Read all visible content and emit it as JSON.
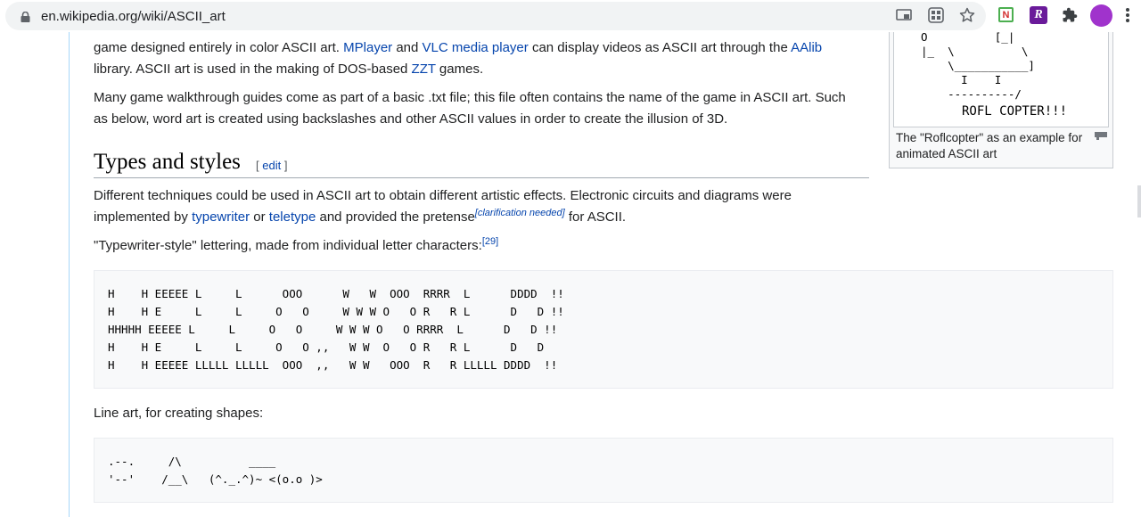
{
  "browser": {
    "url": "en.wikipedia.org/wiki/ASCII_art",
    "extension_n_label": "N",
    "extension_r_label": "R",
    "accent_color": "#a033cc"
  },
  "page": {
    "intro_paragraph": {
      "line1_pre": "game designed entirely in color ASCII art. ",
      "link_mplayer": "MPlayer",
      "line1_and": " and ",
      "link_vlc": "VLC media player",
      "line1_mid": " can display videos as ASCII art through the ",
      "link_aalib": "AAlib",
      "line2_pre": "library. ASCII art is used in the making of DOS-based ",
      "link_zzt": "ZZT",
      "line2_post": " games."
    },
    "walkthrough_paragraph": {
      "line1": "Many game walkthrough guides come as part of a basic .txt file; this file often contains the name of the game in ASCII art. Such",
      "line2": "as below, word art is created using backslashes and other ASCII values in order to create the illusion of 3D."
    },
    "section": {
      "title": "Types and styles",
      "edit_open": "[ ",
      "edit_link": "edit",
      "edit_close": " ]"
    },
    "techniques_paragraph": {
      "line1": "Different techniques could be used in ASCII art to obtain different artistic effects. Electronic circuits and diagrams were",
      "line2_pre": "implemented by ",
      "link_typewriter": "typewriter",
      "line2_or": " or ",
      "link_teletype": "teletype",
      "line2_mid": " and provided the pretense",
      "clarification": "[clarification needed]",
      "line2_post": " for ASCII."
    },
    "typewriter_paragraph": {
      "text": "\"Typewriter-style\" lettering, made from individual letter characters:",
      "citation": "[29]"
    },
    "typewriter_art": "H    H EEEEE L     L      OOO      W   W  OOO  RRRR  L      DDDD  !!\nH    H E     L     L     O   O     W W W O   O R   R L      D   D !!\nHHHHH EEEEE L     L     O   O     W W W O   O RRRR  L      D   D !!\nH    H E     L     L     O   O ,,   W W  O   O R   R L      D   D\nH    H EEEEE LLLLL LLLLL  OOO  ,,   W W   OOO  R   R LLLLL DDDD  !!",
    "line_art_label": "Line art, for creating shapes:",
    "line_art": ".--.     /\\          ____\n'--'    /__\\   (^._.^)~ <(o.o )>",
    "thumbnail": {
      "art": "O          [_|\n|_  \\          \\\n    \\___________]\n      I    I\n    ----------/",
      "copter_text": "ROFL COPTER!!!",
      "caption": "The \"Roflcopter\" as an example for animated ASCII art"
    }
  }
}
